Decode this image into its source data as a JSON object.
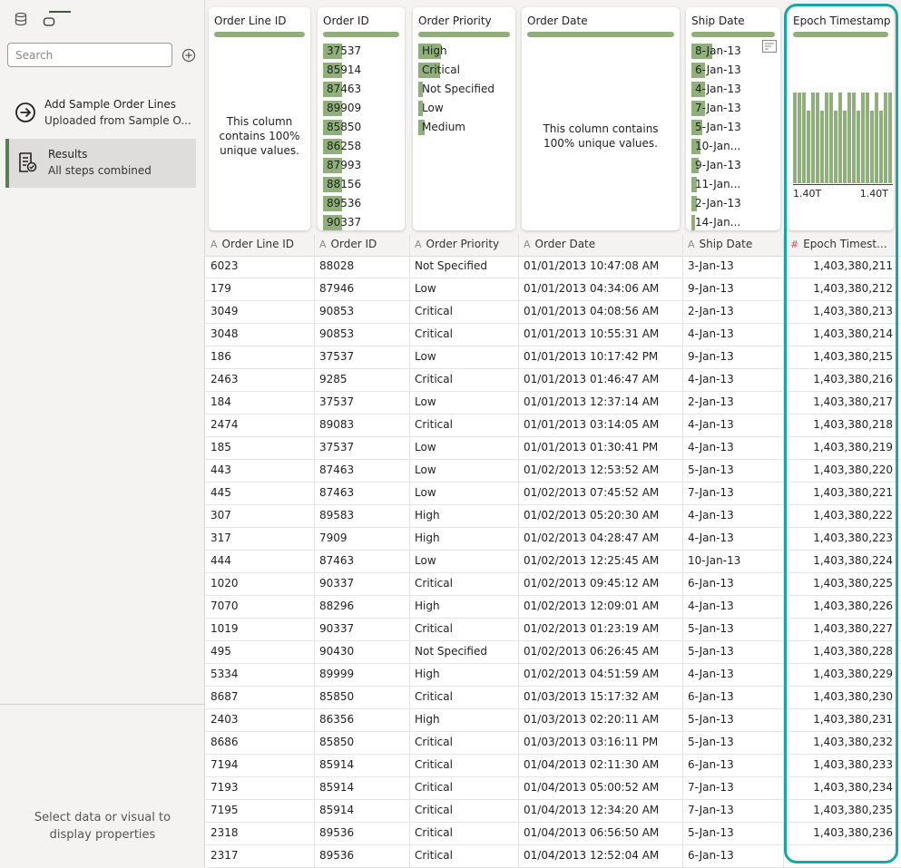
{
  "sidebar": {
    "search_placeholder": "Search",
    "steps": [
      {
        "title": "Add Sample Order Lines",
        "subtitle": "Uploaded from Sample O..."
      },
      {
        "title": "Results",
        "subtitle": "All steps combined"
      }
    ],
    "properties_message": "Select data or visual to display properties"
  },
  "columns": [
    {
      "key": "order_line_id",
      "card_title": "Order Line ID",
      "header": "Order Line ID",
      "type": "text",
      "summary": "This column contains 100% unique values."
    },
    {
      "key": "order_id",
      "card_title": "Order ID",
      "header": "Order ID",
      "type": "text",
      "values": [
        {
          "label": "37537",
          "share": 0.03
        },
        {
          "label": "85914",
          "share": 0.03
        },
        {
          "label": "87463",
          "share": 0.03
        },
        {
          "label": "89909",
          "share": 0.03
        },
        {
          "label": "85850",
          "share": 0.03
        },
        {
          "label": "86258",
          "share": 0.03
        },
        {
          "label": "87993",
          "share": 0.03
        },
        {
          "label": "88156",
          "share": 0.03
        },
        {
          "label": "89536",
          "share": 0.03
        },
        {
          "label": "90337",
          "share": 0.03
        }
      ]
    },
    {
      "key": "order_priority",
      "card_title": "Order Priority",
      "header": "Order Priority",
      "type": "text",
      "values": [
        {
          "label": "High",
          "share": 0.28
        },
        {
          "label": "Critical",
          "share": 0.27
        },
        {
          "label": "Not Specified",
          "share": 0.06
        },
        {
          "label": "Low",
          "share": 0.06
        },
        {
          "label": "Medium",
          "share": 0.08
        }
      ]
    },
    {
      "key": "order_date",
      "card_title": "Order Date",
      "header": "Order Date",
      "type": "text",
      "summary": "This column contains 100% unique values."
    },
    {
      "key": "ship_date",
      "card_title": "Ship Date",
      "header": "Ship Date",
      "type": "text",
      "values": [
        {
          "label": "8-Jan-13",
          "share": 0.12
        },
        {
          "label": "6-Jan-13",
          "share": 0.08
        },
        {
          "label": "4-Jan-13",
          "share": 0.08
        },
        {
          "label": "7-Jan-13",
          "share": 0.08
        },
        {
          "label": "5-Jan-13",
          "share": 0.06
        },
        {
          "label": "10-Jan...",
          "share": 0.05
        },
        {
          "label": "9-Jan-13",
          "share": 0.04
        },
        {
          "label": "11-Jan...",
          "share": 0.03
        },
        {
          "label": "2-Jan-13",
          "share": 0.03
        },
        {
          "label": "14-Jan...",
          "share": 0.02
        }
      ]
    },
    {
      "key": "epoch_timestamp",
      "card_title": "Epoch Timestamp",
      "header": "Epoch Timest...",
      "type": "number",
      "histogram": {
        "min_label": "1.40T",
        "max_label": "1.40T",
        "bins": [
          1,
          1,
          1,
          0.8,
          1,
          1,
          0.8,
          1,
          1,
          0.8,
          1,
          0.8,
          1,
          1,
          0.8,
          1,
          1,
          0.8,
          1,
          0.8,
          1,
          1
        ]
      }
    }
  ],
  "rows": [
    [
      "6023",
      "88028",
      "Not Specified",
      "01/01/2013 10:47:08 AM",
      "3-Jan-13",
      "1,403,380,211"
    ],
    [
      "179",
      "87946",
      "Low",
      "01/01/2013 04:34:06 AM",
      "9-Jan-13",
      "1,403,380,212"
    ],
    [
      "3049",
      "90853",
      "Critical",
      "01/01/2013 04:08:56 AM",
      "2-Jan-13",
      "1,403,380,213"
    ],
    [
      "3048",
      "90853",
      "Critical",
      "01/01/2013 10:55:31 AM",
      "4-Jan-13",
      "1,403,380,214"
    ],
    [
      "186",
      "37537",
      "Low",
      "01/01/2013 10:17:42 PM",
      "9-Jan-13",
      "1,403,380,215"
    ],
    [
      "2463",
      "9285",
      "Critical",
      "01/01/2013 01:46:47 AM",
      "4-Jan-13",
      "1,403,380,216"
    ],
    [
      "184",
      "37537",
      "Low",
      "01/01/2013 12:37:14 AM",
      "2-Jan-13",
      "1,403,380,217"
    ],
    [
      "2474",
      "89083",
      "Critical",
      "01/01/2013 03:14:05 AM",
      "4-Jan-13",
      "1,403,380,218"
    ],
    [
      "185",
      "37537",
      "Low",
      "01/01/2013 01:30:41 PM",
      "4-Jan-13",
      "1,403,380,219"
    ],
    [
      "443",
      "87463",
      "Low",
      "01/02/2013 12:53:52 AM",
      "5-Jan-13",
      "1,403,380,220"
    ],
    [
      "445",
      "87463",
      "Low",
      "01/02/2013 07:45:52 AM",
      "7-Jan-13",
      "1,403,380,221"
    ],
    [
      "307",
      "89583",
      "High",
      "01/02/2013 05:20:30 AM",
      "4-Jan-13",
      "1,403,380,222"
    ],
    [
      "317",
      "7909",
      "High",
      "01/02/2013 04:28:47 AM",
      "4-Jan-13",
      "1,403,380,223"
    ],
    [
      "444",
      "87463",
      "Low",
      "01/02/2013 12:25:45 AM",
      "10-Jan-13",
      "1,403,380,224"
    ],
    [
      "1020",
      "90337",
      "Critical",
      "01/02/2013 09:45:12 AM",
      "6-Jan-13",
      "1,403,380,225"
    ],
    [
      "7070",
      "88296",
      "High",
      "01/02/2013 12:09:01 AM",
      "4-Jan-13",
      "1,403,380,226"
    ],
    [
      "1019",
      "90337",
      "Critical",
      "01/02/2013 01:23:19 AM",
      "5-Jan-13",
      "1,403,380,227"
    ],
    [
      "495",
      "90430",
      "Not Specified",
      "01/02/2013 06:26:45 AM",
      "5-Jan-13",
      "1,403,380,228"
    ],
    [
      "5334",
      "89999",
      "High",
      "01/02/2013 04:51:59 AM",
      "4-Jan-13",
      "1,403,380,229"
    ],
    [
      "8687",
      "85850",
      "Critical",
      "01/03/2013 15:17:32 AM",
      "6-Jan-13",
      "1,403,380,230"
    ],
    [
      "2403",
      "86356",
      "High",
      "01/03/2013 02:20:11 AM",
      "5-Jan-13",
      "1,403,380,231"
    ],
    [
      "8686",
      "85850",
      "Critical",
      "01/03/2013 03:16:11 PM",
      "5-Jan-13",
      "1,403,380,232"
    ],
    [
      "7194",
      "85914",
      "Critical",
      "01/04/2013 02:11:30 AM",
      "6-Jan-13",
      "1,403,380,233"
    ],
    [
      "7193",
      "85914",
      "Critical",
      "01/04/2013 05:00:52 AM",
      "7-Jan-13",
      "1,403,380,234"
    ],
    [
      "7195",
      "85914",
      "Critical",
      "01/04/2013 12:34:20 AM",
      "7-Jan-13",
      "1,403,380,235"
    ],
    [
      "2318",
      "89536",
      "Critical",
      "01/04/2013 06:56:50 AM",
      "5-Jan-13",
      "1,403,380,236"
    ],
    [
      "2317",
      "89536",
      "Critical",
      "01/04/2013 12:52:04 AM",
      "6-Jan-13",
      ""
    ]
  ],
  "colors": {
    "accent_bar": "#8fb07a",
    "highlight": "#1aa5a5",
    "selected_step": "#5b7d5b"
  }
}
